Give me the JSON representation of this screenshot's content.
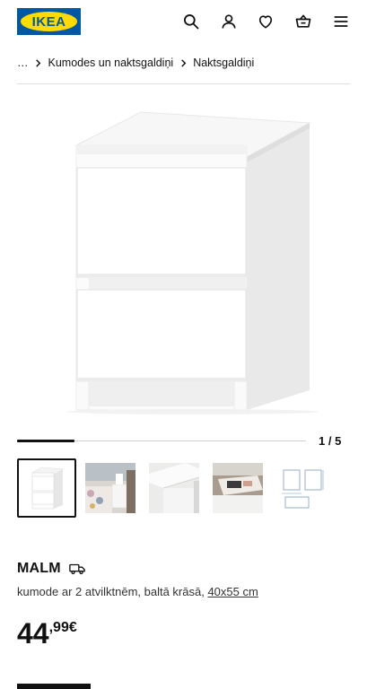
{
  "header": {
    "logo_text": "IKEA",
    "icons": [
      "search-icon",
      "account-icon",
      "heart-icon",
      "basket-icon",
      "menu-icon"
    ],
    "brand_colors": {
      "blue": "#0058a3",
      "yellow": "#ffdb00"
    }
  },
  "breadcrumb": {
    "ellipsis": "…",
    "items": [
      "Kumodes un naktsgaldiņi",
      "Naktsgaldiņi"
    ]
  },
  "gallery": {
    "current": 1,
    "total": 5,
    "counter_text": "1 / 5",
    "progress": 0.2,
    "thumbnails": [
      "front-white-nightstand",
      "bedroom-scene",
      "top-corner-detail",
      "open-drawer-detail",
      "dimensions-drawing"
    ]
  },
  "product": {
    "name": "MALM",
    "description_prefix": "kumode ar 2 atvilktnēm, baltā krāsā,",
    "dimensions": "40x55 cm",
    "price_integer": "44",
    "price_decimals": ",99",
    "currency": "€"
  }
}
